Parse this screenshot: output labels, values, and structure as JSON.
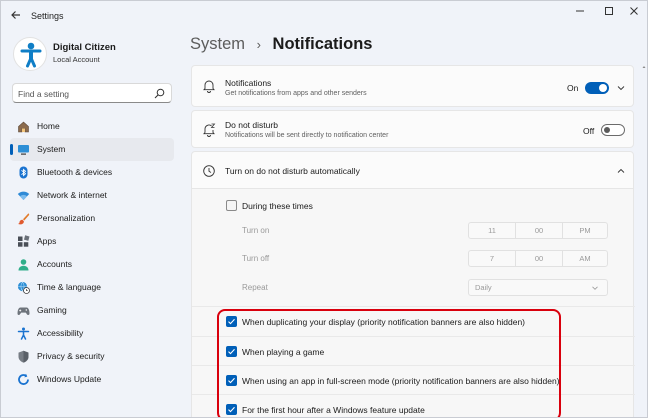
{
  "window": {
    "app_title": "Settings",
    "back_icon": "arrow-left-icon",
    "controls": [
      "minimize-icon",
      "maximize-icon",
      "close-icon"
    ]
  },
  "profile": {
    "name": "Digital Citizen",
    "account_type": "Local Account"
  },
  "search": {
    "placeholder": "Find a setting"
  },
  "sidebar": {
    "items": [
      {
        "label": "Home",
        "icon": "home-icon",
        "active": false
      },
      {
        "label": "System",
        "icon": "system-display-icon",
        "active": true
      },
      {
        "label": "Bluetooth & devices",
        "icon": "bluetooth-icon",
        "active": false
      },
      {
        "label": "Network & internet",
        "icon": "wifi-icon",
        "active": false
      },
      {
        "label": "Personalization",
        "icon": "brush-icon",
        "active": false
      },
      {
        "label": "Apps",
        "icon": "apps-icon",
        "active": false
      },
      {
        "label": "Accounts",
        "icon": "person-icon",
        "active": false
      },
      {
        "label": "Time & language",
        "icon": "globe-clock-icon",
        "active": false
      },
      {
        "label": "Gaming",
        "icon": "gamepad-icon",
        "active": false
      },
      {
        "label": "Accessibility",
        "icon": "accessibility-icon",
        "active": false
      },
      {
        "label": "Privacy & security",
        "icon": "shield-icon",
        "active": false
      },
      {
        "label": "Windows Update",
        "icon": "update-icon",
        "active": false
      }
    ]
  },
  "breadcrumb": {
    "parent": "System",
    "separator": "›",
    "current": "Notifications"
  },
  "notifications": {
    "title": "Notifications",
    "description": "Get notifications from apps and other senders",
    "state_label": "On",
    "enabled": true
  },
  "dnd": {
    "title": "Do not disturb",
    "description": "Notifications will be sent directly to notification center",
    "state_label": "Off",
    "enabled": false
  },
  "auto_dnd": {
    "title": "Turn on do not disturb automatically",
    "during_times": {
      "label": "During these times",
      "checked": false
    },
    "turn_on": {
      "label": "Turn on",
      "hour": "11",
      "minute": "00",
      "period": "PM"
    },
    "turn_off": {
      "label": "Turn off",
      "hour": "7",
      "minute": "00",
      "period": "AM"
    },
    "repeat": {
      "label": "Repeat",
      "value": "Daily"
    },
    "options": [
      {
        "label": "When duplicating your display (priority notification banners are also hidden)",
        "checked": true
      },
      {
        "label": "When playing a game",
        "checked": true
      },
      {
        "label": "When using an app in full-screen mode (priority notification banners are also hidden)",
        "checked": true
      },
      {
        "label": "For the first hour after a Windows feature update",
        "checked": true
      }
    ]
  },
  "colors": {
    "accent": "#005fb8",
    "highlight": "#d9000d"
  }
}
